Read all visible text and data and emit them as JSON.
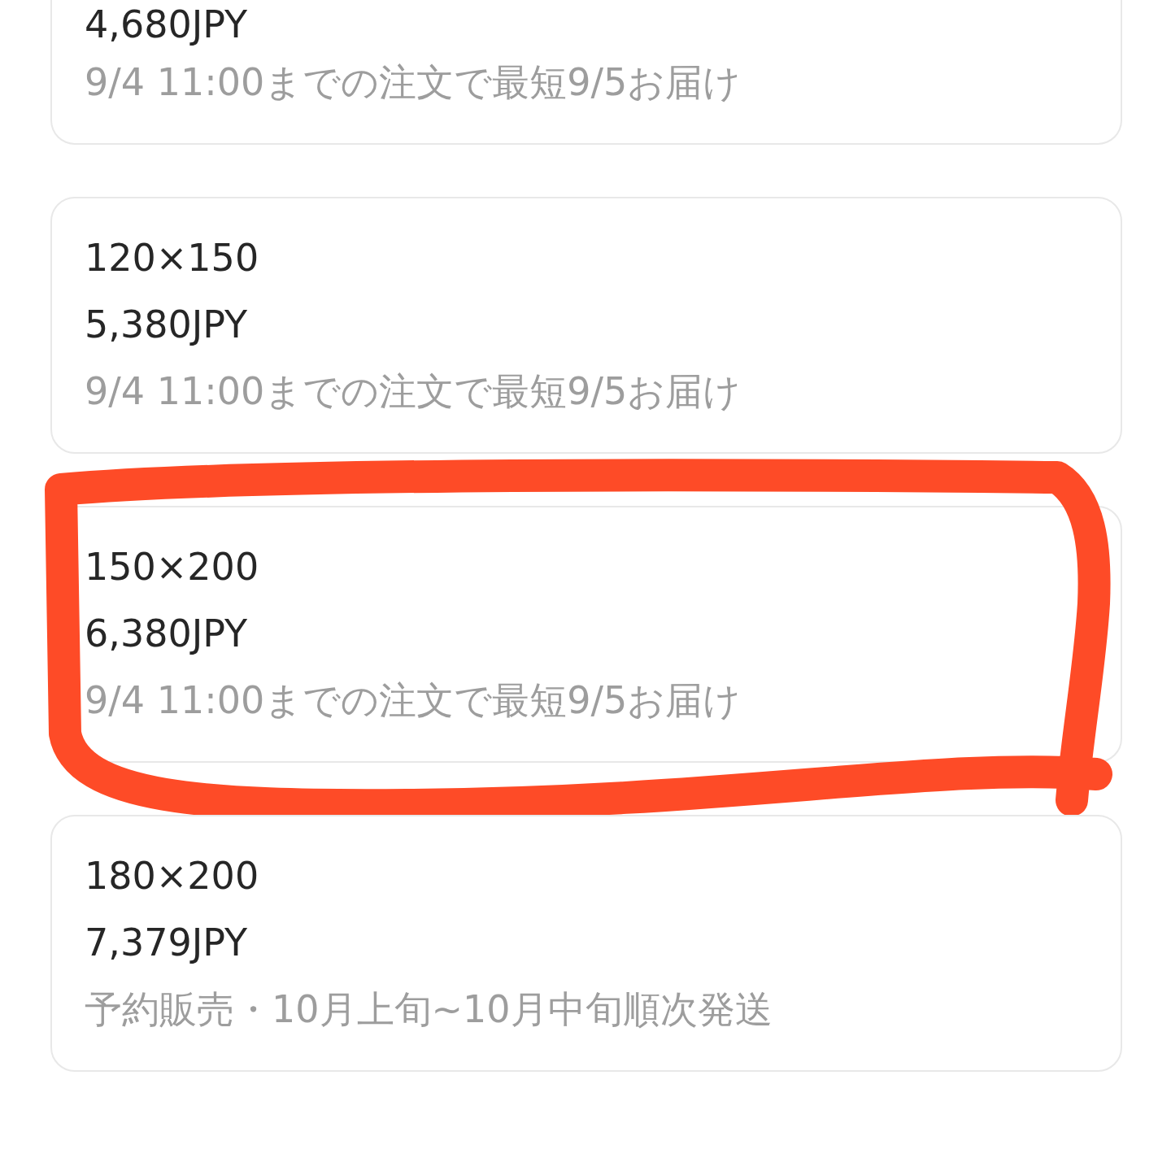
{
  "options": [
    {
      "price": "4,680JPY",
      "delivery": "9/4 11:00までの注文で最短9/5お届け",
      "circled": false
    },
    {
      "size": "120×150",
      "price": "5,380JPY",
      "delivery": "9/4 11:00までの注文で最短9/5お届け",
      "circled": false
    },
    {
      "size": "150×200",
      "price": "6,380JPY",
      "delivery": "9/4 11:00までの注文で最短9/5お届け",
      "circled": true
    },
    {
      "size": "180×200",
      "price": "7,379JPY",
      "delivery": "予約販売・10月上旬~10月中旬順次発送",
      "circled": false
    }
  ]
}
